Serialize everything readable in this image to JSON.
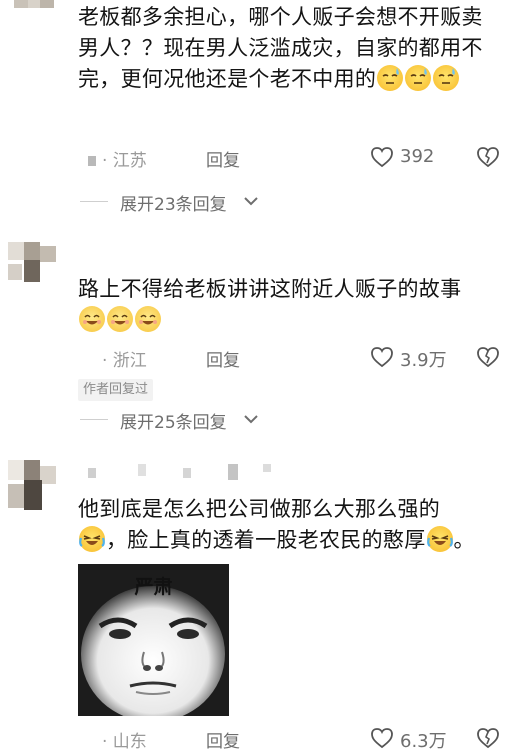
{
  "comments": [
    {
      "text": "老板都多余担心，哪个人贩子会想不开贩卖男人？？现在男人泛滥成灾，自家的都用不完，更何况他还是个老不中用的",
      "location": "· 江苏",
      "reply_label": "回复",
      "likes": "392",
      "expand_label": "展开23条回复"
    },
    {
      "text": "路上不得给老板讲讲这附近人贩子的故事",
      "location": "· 浙江",
      "reply_label": "回复",
      "likes": "3.9万",
      "author_tag": "作者回复过",
      "expand_label": "展开25条回复"
    },
    {
      "text_line1": "他到底是怎么把公司做那么大那么强的",
      "text_line2": "，脸上真的透着一股老农民的憨厚",
      "text_end": "。",
      "meme_caption": "严肃",
      "location": "· 山东",
      "reply_label": "回复",
      "likes": "6.3万"
    }
  ],
  "icons": [
    "heart-icon",
    "dislike-heart-icon",
    "chevron-down-icon",
    "sweat-emoji-icon",
    "laugh-emoji-icon",
    "cry-laugh-emoji-icon"
  ],
  "colors": {
    "text": "#141414",
    "meta": "#9a9a9a",
    "secondary": "#6e6e6e",
    "background": "#ffffff"
  }
}
